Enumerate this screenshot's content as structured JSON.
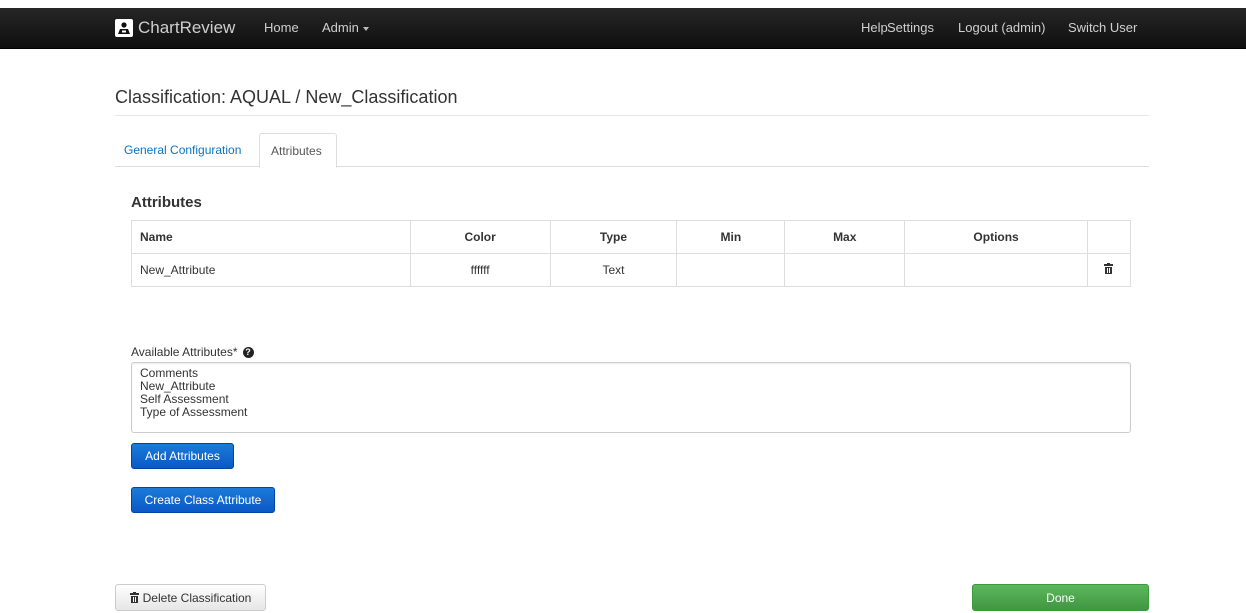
{
  "navbar": {
    "brand": "ChartReview",
    "left_links": [
      {
        "label": "Home"
      },
      {
        "label": "Admin"
      }
    ],
    "right_links": [
      {
        "label": "Help"
      },
      {
        "label": "Settings"
      },
      {
        "label": "Logout (admin)"
      },
      {
        "label": "Switch User"
      }
    ]
  },
  "page": {
    "title": "Classification: AQUAL / New_Classification"
  },
  "tabs": [
    {
      "label": "General Configuration",
      "active": false
    },
    {
      "label": "Attributes",
      "active": true
    }
  ],
  "attributes_section": {
    "heading": "Attributes",
    "columns": [
      "Name",
      "Color",
      "Type",
      "Min",
      "Max",
      "Options",
      ""
    ],
    "rows": [
      {
        "name": "New_Attribute",
        "color": "ffffff",
        "type": "Text",
        "min": "",
        "max": "",
        "options": "",
        "action_icon": "trash-icon"
      }
    ]
  },
  "available_attributes": {
    "label": "Available Attributes*",
    "help_icon": "question-circle-icon",
    "options": [
      "Comments",
      "New_Attribute",
      "Self Assessment",
      "Type of Assessment"
    ]
  },
  "buttons": {
    "add_attributes": "Add Attributes",
    "create_class_attribute": "Create Class Attribute",
    "delete_classification": "Delete Classification",
    "done": "Done"
  },
  "colors": {
    "navbar_bg": "#1a1a1a",
    "link_blue": "#0a74c4",
    "primary_blue": "#0b58c7",
    "success_green": "#5cb85c"
  }
}
